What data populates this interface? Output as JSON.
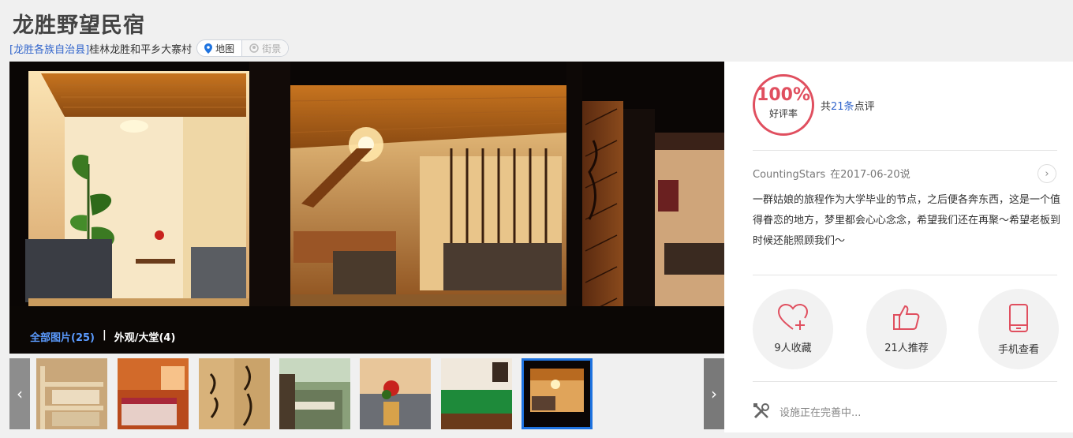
{
  "header": {
    "title": "龙胜野望民宿",
    "county_link": "[龙胜各族自治县]",
    "address": "桂林龙胜和平乡大寨村",
    "map_label": "地图",
    "street_view_label": "街景"
  },
  "gallery": {
    "all_photos_label": "全部图片(25)",
    "separator": "|",
    "category_label": "外观/大堂(4)",
    "thumbnails": [
      "bunk-bed-room",
      "red-bed-room",
      "calligraphy-wall",
      "courtyard",
      "sofa-corner",
      "billiards-room",
      "lobby-night"
    ],
    "active_thumbnail": 7
  },
  "review_panel": {
    "rating_value": "100%",
    "rating_label": "好评率",
    "count_prefix": "共",
    "count_number": "21条",
    "count_suffix": "点评",
    "reviewer": "CountingStars",
    "review_date": "在2017-06-20说",
    "review_text": "一群姑娘的旅程作为大学毕业的节点，之后便各奔东西，这是一个值得眷恋的地方，梦里都会心心念念，希望我们还在再聚～希望老板到时候还能照顾我们～",
    "actions": [
      {
        "label": "9人收藏",
        "icon": "heart-plus-icon"
      },
      {
        "label": "21人推荐",
        "icon": "thumbs-up-icon"
      },
      {
        "label": "手机查看",
        "icon": "mobile-phone-icon"
      }
    ],
    "facility_text": "设施正在完善中...",
    "accent_color": "#e04f5f",
    "link_color": "#3366cc"
  }
}
